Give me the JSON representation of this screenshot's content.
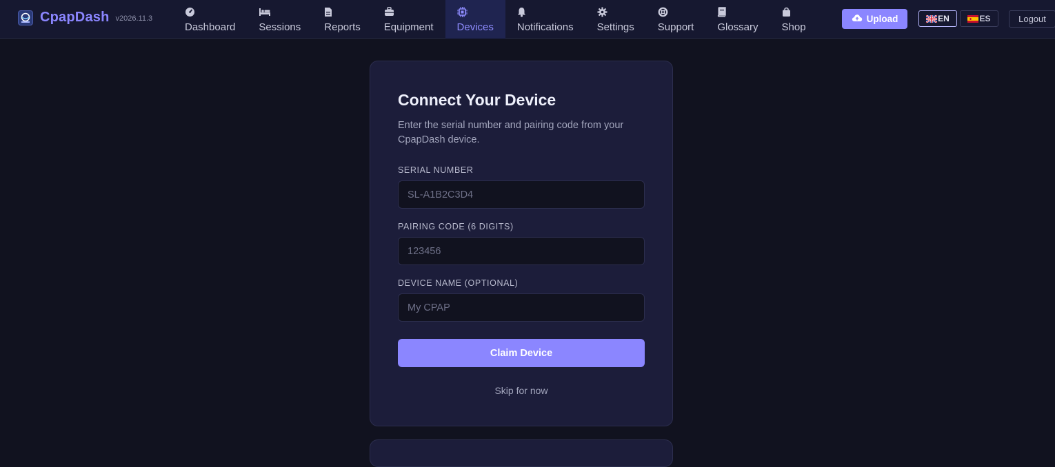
{
  "brand": {
    "name": "CpapDash",
    "version": "v2026.11.3",
    "logo_icon": "cpapdash-logo-icon"
  },
  "nav": {
    "items": [
      {
        "label": "Dashboard",
        "icon": "gauge-icon"
      },
      {
        "label": "Sessions",
        "icon": "bed-icon"
      },
      {
        "label": "Reports",
        "icon": "document-icon"
      },
      {
        "label": "Equipment",
        "icon": "toolbox-icon"
      },
      {
        "label": "Devices",
        "icon": "chip-icon",
        "active": true
      },
      {
        "label": "Notifications",
        "icon": "bell-icon"
      },
      {
        "label": "Settings",
        "icon": "gear-icon"
      },
      {
        "label": "Support",
        "icon": "lifebuoy-icon"
      },
      {
        "label": "Glossary",
        "icon": "book-icon"
      },
      {
        "label": "Shop",
        "icon": "shopping-bag-icon"
      }
    ]
  },
  "header": {
    "upload_label": "Upload",
    "upload_icon": "cloud-upload-icon",
    "lang_en": "EN",
    "lang_es": "ES",
    "logout_label": "Logout"
  },
  "claim_form": {
    "title": "Connect Your Device",
    "description": "Enter the serial number and pairing code from your CpapDash device.",
    "serial_label": "SERIAL NUMBER",
    "serial_placeholder": "SL-A1B2C3D4",
    "serial_value": "",
    "pairing_label": "PAIRING CODE (6 DIGITS)",
    "pairing_placeholder": "123456",
    "pairing_value": "",
    "name_label": "DEVICE NAME (OPTIONAL)",
    "name_placeholder": "My CPAP",
    "name_value": "",
    "submit_label": "Claim Device",
    "skip_label": "Skip for now"
  },
  "colors": {
    "background": "#11121f",
    "topbar": "#161830",
    "card": "#1c1d3a",
    "accent": "#8b86ff",
    "active_nav": "#1f2450"
  }
}
